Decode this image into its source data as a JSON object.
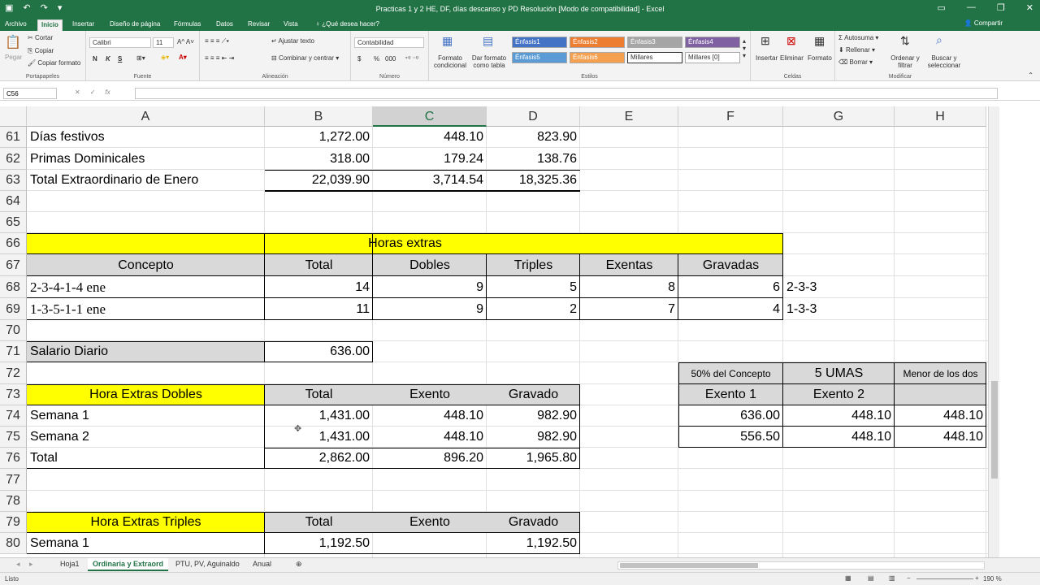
{
  "window": {
    "title": "Practicas 1 y 2 HE, DF, días descanso y PD Resolución  [Modo de compatibilidad] - Excel"
  },
  "ribbon": {
    "tabs": [
      "Archivo",
      "Inicio",
      "Insertar",
      "Diseño de página",
      "Fórmulas",
      "Datos",
      "Revisar",
      "Vista"
    ],
    "tell_me": "¿Qué desea hacer?",
    "share": "Compartir",
    "clipboard": {
      "paste": "Pegar",
      "cut": "Cortar",
      "copy": "Copiar",
      "format_painter": "Copiar formato",
      "label": "Portapapeles"
    },
    "font": {
      "name": "Calibri",
      "size": "11",
      "bold": "N",
      "italic": "K",
      "underline": "S",
      "label": "Fuente"
    },
    "alignment": {
      "wrap": "Ajustar texto",
      "merge": "Combinar y centrar",
      "label": "Alineación"
    },
    "number": {
      "format": "Contabilidad",
      "currency": "$",
      "percent": "%",
      "thousands": "000",
      "label": "Número"
    },
    "styles": {
      "conditional": "Formato condicional",
      "as_table": "Dar formato como tabla",
      "cells": [
        "Énfasis1",
        "Énfasis2",
        "Énfasis3",
        "Énfasis4",
        "Énfasis5",
        "Énfasis6",
        "Millares",
        "Millares [0]"
      ],
      "label": "Estilos"
    },
    "cells": {
      "insert": "Insertar",
      "delete": "Eliminar",
      "format": "Formato",
      "label": "Celdas"
    },
    "editing": {
      "autosum": "Autosuma",
      "fill": "Rellenar",
      "clear": "Borrar",
      "sort": "Ordenar y filtrar",
      "find": "Buscar y seleccionar",
      "label": "Modificar"
    }
  },
  "formula_bar": {
    "name_box": "C56",
    "formula": ""
  },
  "columns": [
    "A",
    "B",
    "C",
    "D",
    "E",
    "F",
    "G",
    "H"
  ],
  "rows": [
    "61",
    "62",
    "63",
    "64",
    "65",
    "66",
    "67",
    "68",
    "69",
    "70",
    "71",
    "72",
    "73",
    "74",
    "75",
    "76",
    "77",
    "78",
    "79",
    "80"
  ],
  "cells": {
    "A61": "Días festivos",
    "B61": "1,272.00",
    "C61": "448.10",
    "D61": "823.90",
    "A62": "Primas Dominicales",
    "B62": "318.00",
    "C62": "179.24",
    "D62": "138.76",
    "A63": "Total Extraordinario de Enero",
    "B63": "22,039.90",
    "C63": "3,714.54",
    "D63": "18,325.36",
    "A66": "Horas extras",
    "A67": "Concepto",
    "B67": "Total",
    "C67": "Dobles",
    "D67": "Triples",
    "E67": "Exentas",
    "F67": "Gravadas",
    "A68": "2-3-4-1-4 ene",
    "B68": "14",
    "C68": "9",
    "D68": "5",
    "E68": "8",
    "F68": "6",
    "G68": "2-3-3",
    "A69": "1-3-5-1-1 ene",
    "B69": "11",
    "C69": "9",
    "D69": "2",
    "E69": "7",
    "F69": "4",
    "G69": "1-3-3",
    "A71": "Salario Diario",
    "B71": "636.00",
    "F72": "50% del Concepto",
    "G72": "5 UMAS",
    "H72": "Menor de los dos",
    "A73": "Hora Extras Dobles",
    "B73": "Total",
    "C73": "Exento",
    "D73": "Gravado",
    "F73": "Exento 1",
    "G73": "Exento 2",
    "A74": "Semana 1",
    "B74": "1,431.00",
    "C74": "448.10",
    "D74": "982.90",
    "F74": "636.00",
    "G74": "448.10",
    "H74": "448.10",
    "A75": "Semana 2",
    "B75": "1,431.00",
    "C75": "448.10",
    "D75": "982.90",
    "F75": "556.50",
    "G75": "448.10",
    "H75": "448.10",
    "A76": "Total",
    "B76": "2,862.00",
    "C76": "896.20",
    "D76": "1,965.80",
    "A79": "Hora Extras Triples",
    "B79": "Total",
    "C79": "Exento",
    "D79": "Gravado",
    "A80": "Semana 1",
    "B80": "1,192.50",
    "D80": "1,192.50"
  },
  "sheets": [
    "Hoja1",
    "Ordinaria y Extraord",
    "PTU, PV, Aguinaldo",
    "Anual"
  ],
  "active_sheet": "Ordinaria y Extraord",
  "status": {
    "mode": "Listo",
    "zoom": "190 %"
  },
  "colors": {
    "excel_green": "#217346",
    "yellow": "#ffff00",
    "header_gray": "#d9d9d9"
  }
}
